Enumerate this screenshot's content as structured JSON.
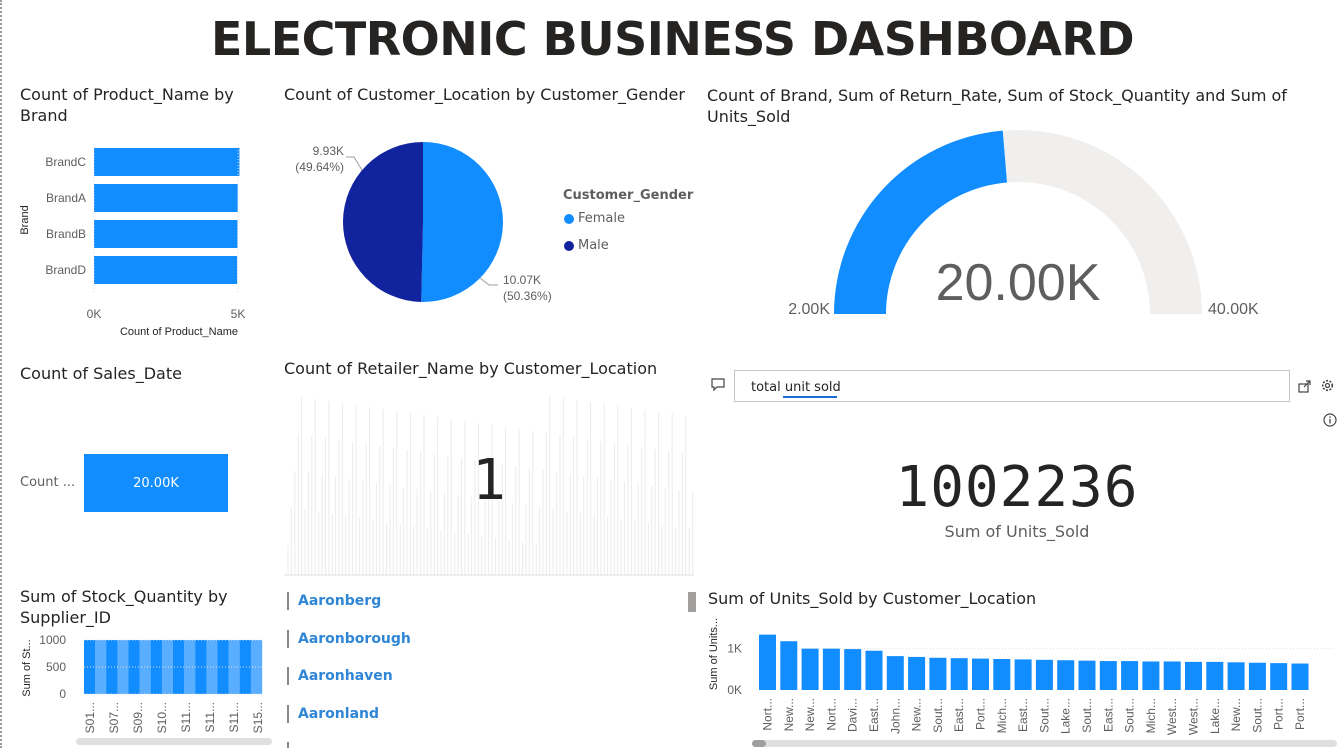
{
  "title": "ELECTRONIC BUSINESS DASHBOARD",
  "colors": {
    "primary": "#118dff",
    "dark": "#12239e",
    "track": "#f0efee",
    "link": "#2f86d6"
  },
  "brand_chart": {
    "title": "Count of Product_Name by Brand",
    "ylabel": "Brand",
    "xlabel": "Count of Product_Name",
    "ticks": [
      "0K",
      "5K"
    ]
  },
  "gender_chart": {
    "title": "Count of Customer_Location by Customer_Gender",
    "legend_title": "Customer_Gender",
    "label_male_value": "9.93K",
    "label_male_pct": "(49.64%)",
    "label_female_value": "10.07K",
    "label_female_pct": "(50.36%)",
    "legend": [
      "Female",
      "Male"
    ]
  },
  "gauge": {
    "title": "Count of Brand, Sum of Return_Rate, Sum of Stock_Quantity and Sum of Units_Sold",
    "value_label": "20.00K",
    "min_label": "2.00K",
    "max_label": "40.00K"
  },
  "sales_card": {
    "title": "Count of Sales_Date",
    "row_label": "Count ...",
    "value_label": "20.00K"
  },
  "retailer_chart": {
    "title": "Count of Retailer_Name by Customer_Location",
    "center_value": "1"
  },
  "qna": {
    "query": "total unit sold",
    "value": "1002236",
    "subtitle": "Sum of Units_Sold"
  },
  "stock_chart": {
    "title": "Sum of Stock_Quantity by Supplier_ID",
    "ylabel": "Sum of St...",
    "yticks": [
      "1000",
      "500",
      "0"
    ],
    "xlabels": [
      "S01...",
      "S07...",
      "S09...",
      "S10...",
      "S11...",
      "S11...",
      "S11...",
      "S15..."
    ]
  },
  "location_slicer": {
    "items": [
      "Aaronberg",
      "Aaronborough",
      "Aaronhaven",
      "Aaronland"
    ]
  },
  "units_chart": {
    "title": "Sum of Units_Sold by Customer_Location",
    "ylabel": "Sum of Units...",
    "yticks": [
      "1K",
      "0K"
    ],
    "xlabels": [
      "Nort...",
      "New...",
      "New...",
      "Nort...",
      "Davi...",
      "East...",
      "John...",
      "New...",
      "Sout...",
      "East...",
      "Port...",
      "Mich...",
      "East...",
      "Sout...",
      "Lake...",
      "Sout...",
      "East...",
      "Sout...",
      "Mich...",
      "West...",
      "West...",
      "Lake...",
      "New...",
      "Sout...",
      "Port...",
      "Port..."
    ]
  },
  "chart_data": [
    {
      "type": "bar",
      "orientation": "horizontal",
      "title": "Count of Product_Name by Brand",
      "xlabel": "Count of Product_Name",
      "ylabel": "Brand",
      "categories": [
        "BrandC",
        "BrandA",
        "BrandB",
        "BrandD"
      ],
      "values": [
        5050,
        4990,
        4980,
        4970
      ],
      "xlim": [
        0,
        5000
      ]
    },
    {
      "type": "pie",
      "title": "Count of Customer_Location by Customer_Gender",
      "categories": [
        "Female",
        "Male"
      ],
      "values": [
        10070,
        9930
      ],
      "percentages": [
        50.36,
        49.64
      ],
      "colors": [
        "#118dff",
        "#12239e"
      ],
      "legend_placement": "right"
    },
    {
      "type": "gauge",
      "title": "Count of Brand, Sum of Return_Rate, Sum of Stock_Quantity and Sum of Units_Sold",
      "value": 20000,
      "min": 2000,
      "max": 40000
    },
    {
      "type": "bar",
      "orientation": "horizontal",
      "title": "Count of Sales_Date",
      "categories": [
        "Count ..."
      ],
      "values": [
        20000
      ]
    },
    {
      "type": "bar",
      "title": "Sum of Stock_Quantity by Supplier_ID",
      "ylabel": "Sum of St...",
      "x": [
        "S01...",
        "S07...",
        "S09...",
        "S10...",
        "S11...",
        "S11...",
        "S11...",
        "S15..."
      ],
      "values": [
        1000,
        1000,
        1000,
        1000,
        1000,
        1000,
        1000,
        1000,
        1000,
        1000,
        1000,
        1000,
        1000,
        1000,
        1000,
        1000
      ],
      "ylim": [
        0,
        1000
      ]
    },
    {
      "type": "bar",
      "title": "Sum of Units_Sold by Customer_Location",
      "ylabel": "Sum of Units...",
      "categories": [
        "Nort...",
        "New...",
        "New...",
        "Nort...",
        "Davi...",
        "East...",
        "John...",
        "New...",
        "Sout...",
        "East...",
        "Port...",
        "Mich...",
        "East...",
        "Sout...",
        "Lake...",
        "Sout...",
        "East...",
        "Sout...",
        "Mich...",
        "West...",
        "West...",
        "Lake...",
        "New...",
        "Sout...",
        "Port...",
        "Port..."
      ],
      "values": [
        1340,
        1180,
        1000,
        1000,
        990,
        950,
        820,
        800,
        780,
        770,
        760,
        750,
        740,
        730,
        720,
        710,
        700,
        700,
        690,
        690,
        680,
        680,
        670,
        660,
        650,
        640
      ],
      "ylim": [
        0,
        1500
      ]
    }
  ]
}
